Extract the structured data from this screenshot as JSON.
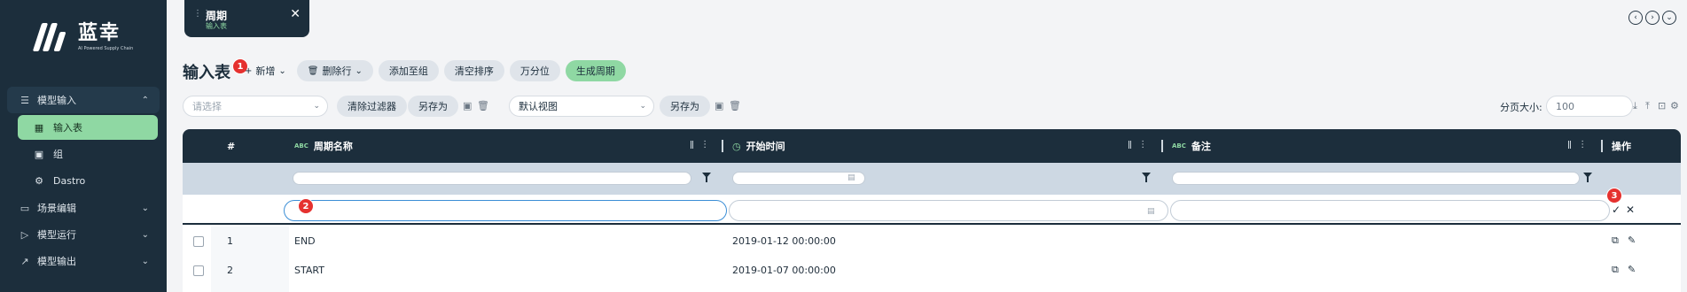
{
  "brand": {
    "name": "蓝幸",
    "tagline": "AI Powered Supply Chain"
  },
  "sidebar": {
    "groups": [
      {
        "label": "模型输入",
        "icon": "list-icon",
        "expanded": true,
        "items": [
          {
            "label": "输入表",
            "icon": "table-icon",
            "active": true
          },
          {
            "label": "组",
            "icon": "group-icon",
            "active": false
          },
          {
            "label": "Dastro",
            "icon": "gear-icon",
            "active": false
          }
        ]
      },
      {
        "label": "场景编辑",
        "icon": "monitor-icon",
        "expanded": false
      },
      {
        "label": "模型运行",
        "icon": "play-icon",
        "expanded": false
      },
      {
        "label": "模型输出",
        "icon": "chart-icon",
        "expanded": false
      }
    ]
  },
  "tab": {
    "title": "周期",
    "subtitle": "输入表"
  },
  "page": {
    "title": "输入表"
  },
  "toolbar": {
    "add_label": "新增",
    "delete_label": "删除行",
    "add_to_group": "添加至组",
    "clear_sort": "清空排序",
    "percentile": "万分位",
    "generate": "生成周期"
  },
  "filterbar": {
    "select_placeholder": "请选择",
    "clear_filter": "清除过滤器",
    "save_as_1": "另存为",
    "view_value": "默认视图",
    "save_as_2": "另存为",
    "page_size_label": "分页大小:",
    "page_size_value": "100"
  },
  "grid": {
    "columns": {
      "index": "#",
      "name": "周期名称",
      "start": "开始时间",
      "note": "备注",
      "action": "操作"
    },
    "type_badge": "ABC",
    "rows": [
      {
        "index": "1",
        "name": "END",
        "start": "2019-01-12 00:00:00",
        "note": ""
      },
      {
        "index": "2",
        "name": "START",
        "start": "2019-01-07 00:00:00",
        "note": ""
      }
    ]
  },
  "badges": {
    "b1": "1",
    "b2": "2",
    "b3": "3"
  },
  "colors": {
    "sidebar_bg": "#1c2e3c",
    "accent_green": "#8fd8a3",
    "badge_red": "#e5312f",
    "filter_row_bg": "#cdd8e3"
  }
}
